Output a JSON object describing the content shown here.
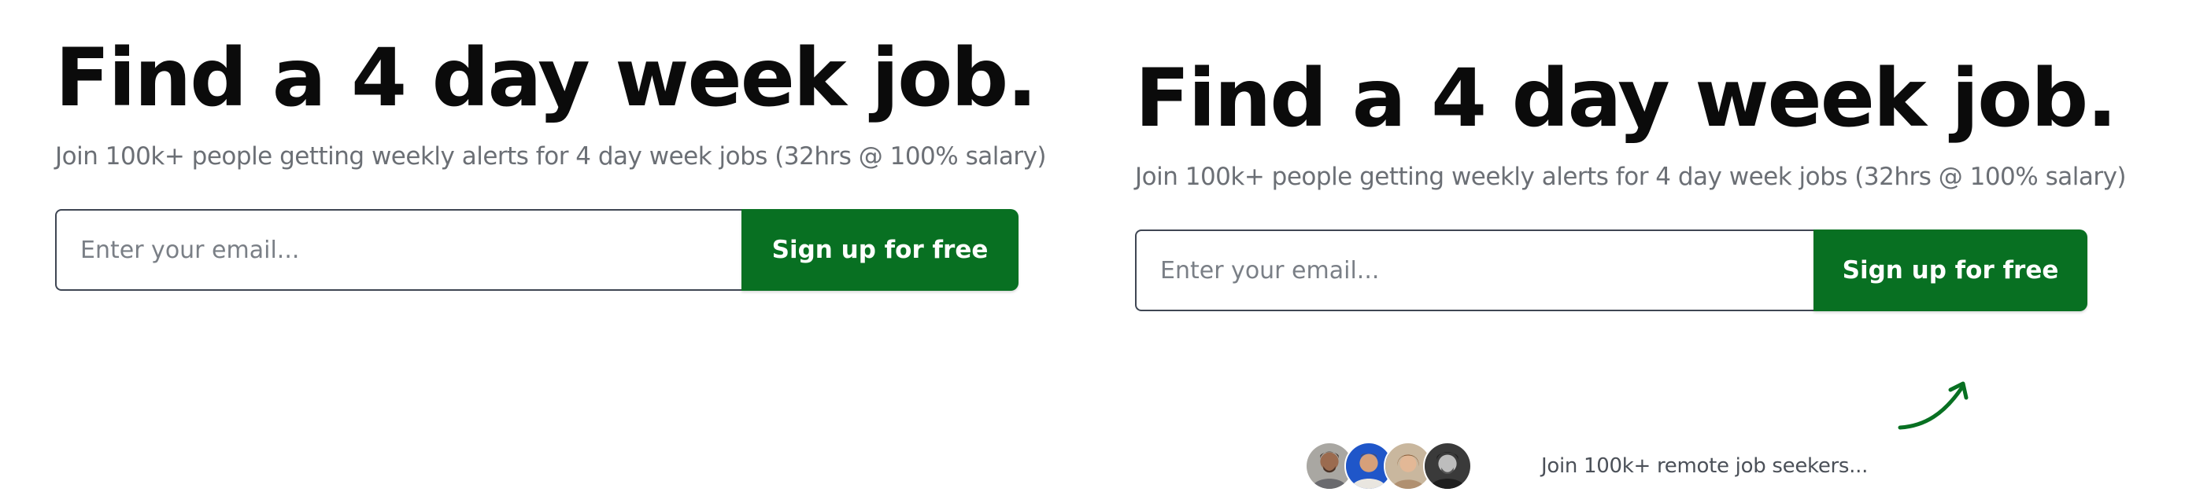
{
  "left_variant": {
    "headline": "Find a 4 day week job.",
    "subtitle": "Join 100k+ people getting weekly alerts for 4 day week jobs (32hrs @ 100% salary)",
    "email_field": {
      "value": "",
      "placeholder": "Enter your email..."
    },
    "signup_button_label": "Sign up for free"
  },
  "right_variant": {
    "headline": "Find a 4 day week job.",
    "subtitle": "Join 100k+ people getting weekly alerts for 4 day week jobs (32hrs @ 100% salary)",
    "email_field": {
      "value": "",
      "placeholder": "Enter your email..."
    },
    "signup_button_label": "Sign up for free",
    "arrow_icon": "curved-arrow-icon",
    "social_proof": {
      "avatars": [
        "avatar-1",
        "avatar-2",
        "avatar-3",
        "avatar-4"
      ],
      "text": "Join 100k+ remote job seekers..."
    }
  },
  "colors": {
    "brand_green": "#087022",
    "headline": "#0b0b0b",
    "subtitle": "#6b6f75",
    "input_border": "#3f4653"
  }
}
